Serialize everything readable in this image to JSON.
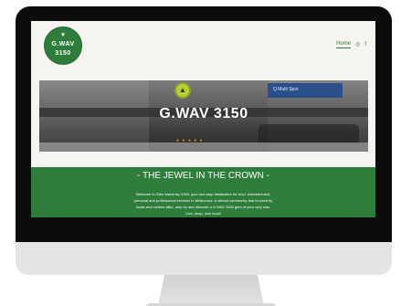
{
  "logo": {
    "icon": "heart-icon",
    "line1": "G.WAV",
    "line2": "3150",
    "color": "#2f7d3b"
  },
  "nav": {
    "home_label": "Home",
    "icons": [
      "instagram-icon",
      "facebook-icon"
    ]
  },
  "hero": {
    "title": "G.WAV 3150",
    "sign_text": "Q Multi Spot"
  },
  "intro": {
    "heading": "- THE JEWEL IN THE CROWN -",
    "body": "Welcome to Glen Waverley 3150, your one-stop destination for food, entertainment, personal and professional services in Melbourne. A vibrant community that is loved by locals and visitors alike, stop by and discover a G.WAV 3150 gem of your very own. Live, shop, love local!",
    "background_color": "#2f7d3b"
  }
}
